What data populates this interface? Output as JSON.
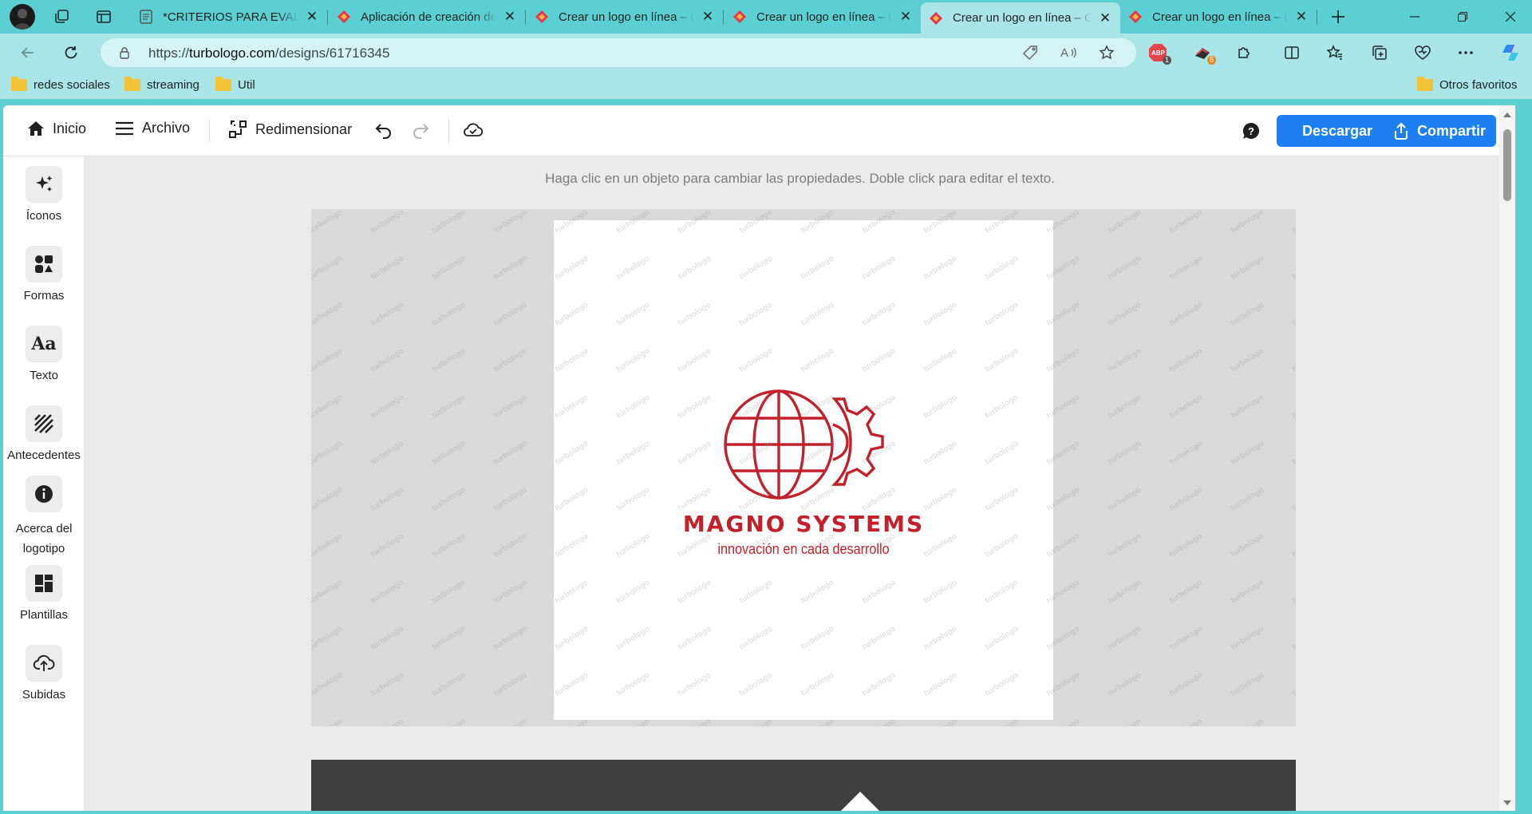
{
  "browser": {
    "tabs": [
      {
        "title": "*CRITERIOS PARA EVALUAR",
        "favicon": "document-icon",
        "active": false
      },
      {
        "title": "Aplicación de creación de logos",
        "favicon": "turbologo-icon",
        "active": false
      },
      {
        "title": "Crear un logo en línea – Gratis",
        "favicon": "turbologo-icon",
        "active": false
      },
      {
        "title": "Crear un logo en línea – Gratis",
        "favicon": "turbologo-icon",
        "active": false
      },
      {
        "title": "Crear un logo en línea – Gratis",
        "favicon": "turbologo-icon",
        "active": true
      },
      {
        "title": "Crear un logo en línea – Gratis",
        "favicon": "turbologo-icon",
        "active": false
      }
    ],
    "url_prefix": "https://",
    "url_domain": "turbologo.com",
    "url_path": "/designs/61716345",
    "extensions": {
      "abp_badge": "1",
      "ext2_badge": "8"
    },
    "bookmarks": [
      "redes sociales",
      "streaming",
      "Util"
    ],
    "other_favorites": "Otros favoritos",
    "colors": {
      "frame": "#5ccfd3",
      "toolbar": "#a9e4e6"
    }
  },
  "editor": {
    "toolbar": {
      "home": "Inicio",
      "file": "Archivo",
      "resize": "Redimensionar",
      "download": "Descargar",
      "share": "Compartir"
    },
    "sidebar": [
      {
        "label": "Íconos",
        "icon": "sparkles-icon"
      },
      {
        "label": "Formas",
        "icon": "shapes-icon"
      },
      {
        "label": "Texto",
        "icon": "text-icon"
      },
      {
        "label": "Antecedentes",
        "icon": "background-icon"
      },
      {
        "label": "Acerca del logotipo",
        "icon": "info-icon"
      },
      {
        "label": "Plantillas",
        "icon": "templates-icon"
      },
      {
        "label": "Subidas",
        "icon": "upload-icon"
      }
    ],
    "hint": "Haga clic en un objeto para cambiar las propiedades. Doble click para editar el texto.",
    "logo": {
      "name": "MAGNO SYSTEMS",
      "slogan": "innovación en cada desarrollo",
      "color": "#c2212b"
    },
    "watermark": "turbologo",
    "accent": "#1d7ff0"
  }
}
